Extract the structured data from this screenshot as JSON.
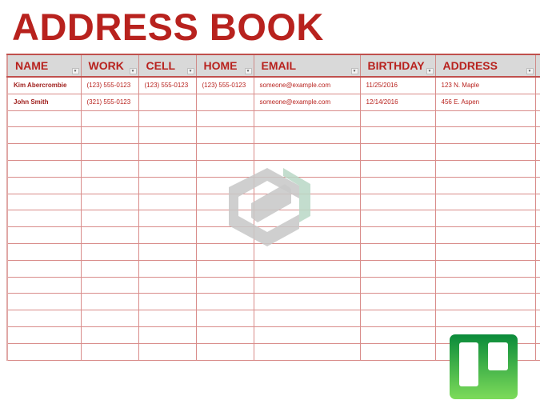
{
  "title": "ADDRESS BOOK",
  "columns": [
    "NAME",
    "WORK",
    "CELL",
    "HOME",
    "EMAIL",
    "BIRTHDAY",
    "ADDRESS"
  ],
  "rows": [
    [
      "Kim Abercrombie",
      "(123) 555-0123",
      "(123) 555-0123",
      "(123) 555-0123",
      "someone@example.com",
      "11/25/2016",
      "123 N. Maple"
    ],
    [
      "John Smith",
      "(321) 555-0123",
      "",
      "",
      "someone@example.com",
      "12/14/2016",
      "456 E. Aspen"
    ]
  ],
  "empty_row_count": 15,
  "filter_icon": "dropdown-filter-icon",
  "watermark_icon": "watermark-logo-icon",
  "app_icon": "trello-board-icon",
  "colors": {
    "accent": "#b8221e",
    "header_bg": "#d9d9d9",
    "grid": "#d98c8a"
  }
}
